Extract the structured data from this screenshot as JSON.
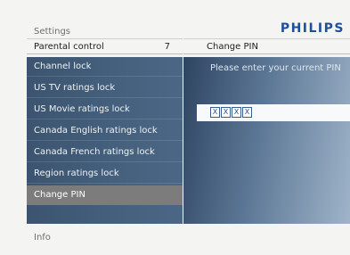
{
  "header": {
    "title": "Settings",
    "brand": "PHILIPS"
  },
  "left_panel": {
    "title": "Parental control",
    "number": "7",
    "items": [
      {
        "label": "Channel lock"
      },
      {
        "label": "US TV ratings lock"
      },
      {
        "label": "US Movie ratings lock"
      },
      {
        "label": "Canada English ratings lock"
      },
      {
        "label": "Canada French ratings lock"
      },
      {
        "label": "Region ratings lock"
      },
      {
        "label": "Change PIN",
        "selected": true
      }
    ]
  },
  "right_panel": {
    "title": "Change PIN",
    "prompt": "Please enter your current PIN",
    "pin": [
      "X",
      "X",
      "X",
      "X"
    ]
  },
  "footer": {
    "info_label": "Info"
  },
  "colors": {
    "brand": "#1f4f9a",
    "selected_item": "#7c7c7c",
    "menu_bg": "#44607c"
  }
}
